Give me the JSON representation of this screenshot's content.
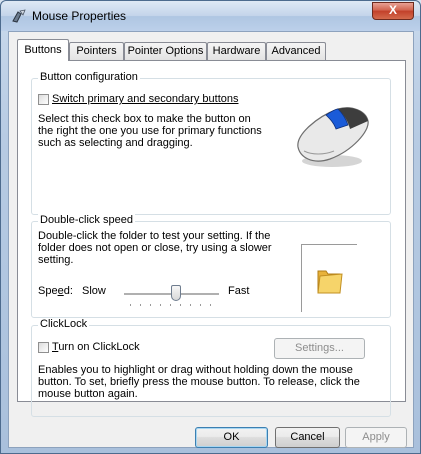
{
  "window": {
    "title": "Mouse Properties",
    "close_glyph": "X"
  },
  "tabs": [
    {
      "label": "Buttons"
    },
    {
      "label": "Pointers"
    },
    {
      "label": "Pointer Options"
    },
    {
      "label": "Hardware"
    },
    {
      "label": "Advanced"
    }
  ],
  "button_config": {
    "title": "Button configuration",
    "checkbox_label": "Switch primary and secondary buttons",
    "description": "Select this check box to make the button on the right the one you use for primary functions such as selecting and dragging."
  },
  "double_click": {
    "title": "Double-click speed",
    "description": "Double-click the folder to test your setting. If the folder does not open or close, try using a slower setting.",
    "speed_label": "Speed:",
    "slow_label": "Slow",
    "fast_label": "Fast",
    "speed_value": 0.55
  },
  "clicklock": {
    "title": "ClickLock",
    "checkbox_label": "Turn on ClickLock",
    "settings_label": "Settings...",
    "description": "Enables you to highlight or drag without holding down the mouse button. To set, briefly press the mouse button. To release, click the mouse button again."
  },
  "footer": {
    "ok_label": "OK",
    "cancel_label": "Cancel",
    "apply_label": "Apply"
  },
  "colors": {
    "accent": "#3c7fb1",
    "close_button": "#c2402a"
  }
}
